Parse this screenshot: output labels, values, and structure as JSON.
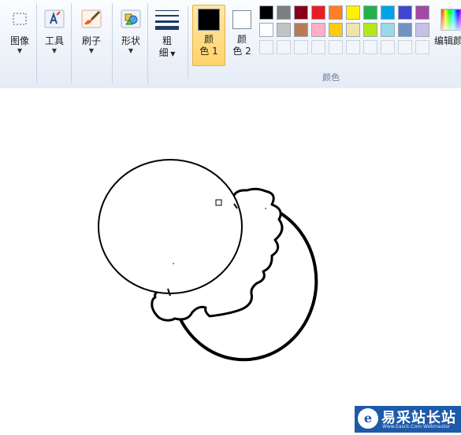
{
  "toolbar": {
    "image_label": "图像",
    "tools_label": "工具",
    "brush_label": "刷子",
    "shapes_label": "形状",
    "size_label_top": "粗",
    "size_label_bottom": "细",
    "color1_top": "颜",
    "color1_bottom": "色 1",
    "color2_top": "颜",
    "color2_bottom": "色 2",
    "edit_colors_label": "编辑颜",
    "colors_group_caption": "颜色"
  },
  "colors": {
    "color1": "#000000",
    "color2": "#ffffff",
    "palette_row1": [
      "#000000",
      "#7f7f7f",
      "#880015",
      "#ed1c24",
      "#ff7f27",
      "#fff200",
      "#22b14c",
      "#00a2e8",
      "#3f48cc",
      "#a349a4"
    ],
    "palette_row2": [
      "#ffffff",
      "#c3c3c3",
      "#b97a57",
      "#ffaec9",
      "#ffc90e",
      "#efe4b0",
      "#b5e61d",
      "#99d9ea",
      "#7092be",
      "#c8bfe7"
    ],
    "accent": "#1e5aa8"
  },
  "icons": {
    "image": "select-rectangle-icon",
    "tools": "text-tool-icon",
    "brush": "brush-icon",
    "shapes": "shapes-icon",
    "size": "line-size-icon",
    "edit_colors": "color-spectrum-icon"
  },
  "watermark": {
    "logo": "e",
    "title": "易采站长站",
    "subtitle": "Www.Easck.Com  Webmaster"
  }
}
